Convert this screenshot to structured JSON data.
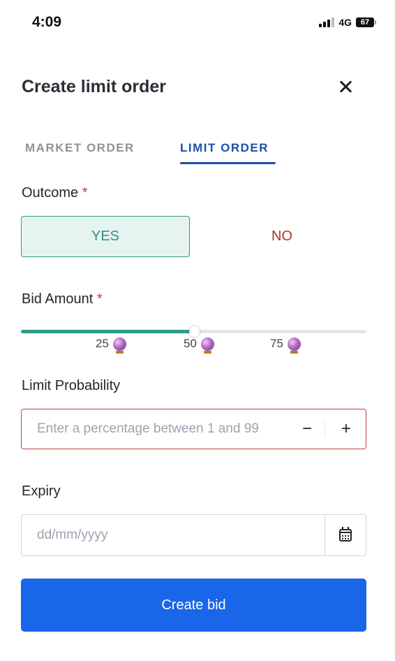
{
  "status_bar": {
    "time": "4:09",
    "network": "4G",
    "battery": "67"
  },
  "header": {
    "title": "Create limit order"
  },
  "tabs": [
    {
      "label": "MARKET ORDER",
      "active": false
    },
    {
      "label": "LIMIT ORDER",
      "active": true
    }
  ],
  "outcome": {
    "label": "Outcome",
    "required_mark": "*",
    "options": [
      {
        "label": "YES",
        "selected": true
      },
      {
        "label": "NO",
        "selected": false
      }
    ]
  },
  "bid_amount": {
    "label": "Bid Amount",
    "required_mark": "*",
    "slider_value": 50,
    "slider_max": 100,
    "ticks": [
      "25",
      "50",
      "75"
    ],
    "tick_icon": "crystal-ball-icon"
  },
  "limit_probability": {
    "label": "Limit Probability",
    "placeholder": "Enter a percentage between 1 and 99",
    "minus": "−",
    "plus": "+"
  },
  "expiry": {
    "label": "Expiry",
    "placeholder": "dd/mm/yyyy",
    "icon": "calendar-icon"
  },
  "submit": {
    "label": "Create bid"
  },
  "colors": {
    "accent_blue": "#1966e8",
    "tab_active": "#1b4fa8",
    "yes_green": "#2e9b86",
    "no_red": "#b52f2f",
    "error_border": "#c24141"
  }
}
